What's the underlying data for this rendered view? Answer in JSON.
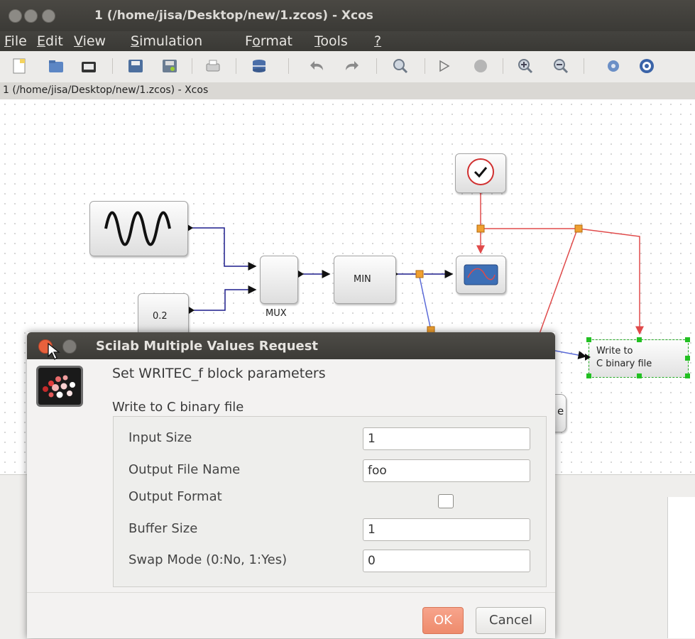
{
  "window": {
    "title": "1 (/home/jisa/Desktop/new/1.zcos) - Xcos"
  },
  "menu": [
    {
      "label": "File",
      "u": "F"
    },
    {
      "label": "Edit",
      "u": "E"
    },
    {
      "label": "View",
      "u": "V"
    },
    {
      "label": "Simulation",
      "u": "S"
    },
    {
      "label": "Format",
      "u": "o"
    },
    {
      "label": "Tools",
      "u": "T"
    },
    {
      "label": "?",
      "u": "?"
    }
  ],
  "tab": {
    "label": "1 (/home/jisa/Desktop/new/1.zcos) - Xcos"
  },
  "toolbar_icons": [
    "new-icon",
    "open-icon",
    "open-folder-icon",
    "save-icon",
    "save-as-icon",
    "print-icon",
    "db-icon",
    "undo-icon",
    "redo-icon",
    "zoom-fit-icon",
    "play-icon",
    "stop-icon",
    "zoom-in-icon",
    "zoom-out-icon",
    "settings-icon",
    "help-icon"
  ],
  "diagram": {
    "const_value": "0.2",
    "mux_label": "MUX",
    "min_label": "MIN",
    "write_label_1": "Write to",
    "write_label_2": "C binary file"
  },
  "dialog": {
    "title": "Scilab Multiple Values Request",
    "heading": "Set WRITEC_f block parameters",
    "subheading": "Write to C binary file",
    "fields": [
      {
        "label": "Input Size",
        "value": "1"
      },
      {
        "label": "Output File Name",
        "value": "foo"
      },
      {
        "label": "Output Format",
        "checked": false
      },
      {
        "label": "Buffer Size",
        "value": "1"
      },
      {
        "label": "Swap Mode (0:No, 1:Yes)",
        "value": "0"
      }
    ],
    "ok_label": "OK",
    "cancel_label": "Cancel"
  },
  "colors": {
    "signal_link": "#1c1c8c",
    "event_link": "#e04a4a",
    "ok_button": "#f0917a",
    "accent_orange": "#f0a030"
  }
}
